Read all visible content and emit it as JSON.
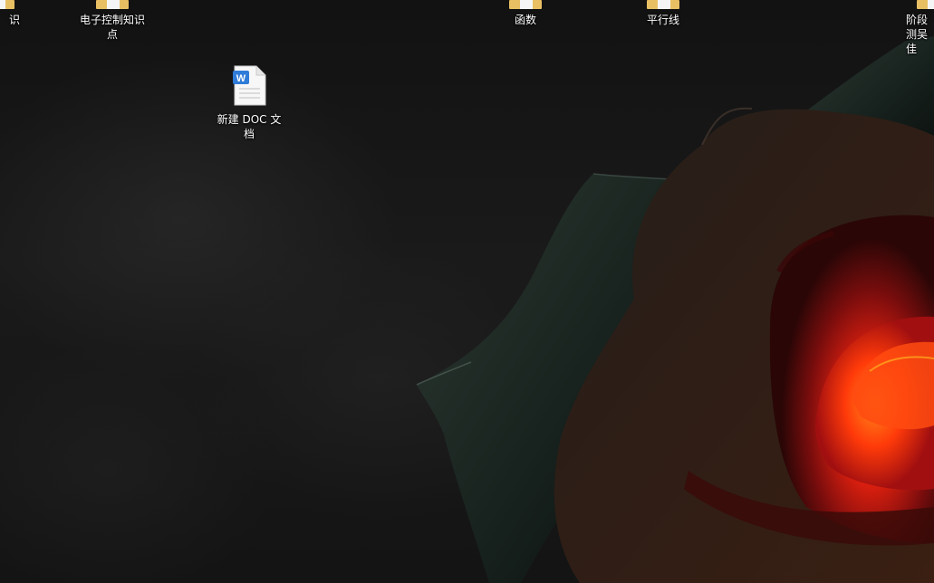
{
  "desktop": {
    "icons": [
      {
        "label": "识",
        "type": "folder"
      },
      {
        "label": "电子控制知识点",
        "type": "folder"
      },
      {
        "label": "函数",
        "type": "folder"
      },
      {
        "label": "平行线",
        "type": "folder"
      },
      {
        "label": "阶段测吴佳",
        "type": "folder"
      },
      {
        "label": "新建 DOC 文档",
        "type": "word-document",
        "badge": "W"
      }
    ]
  }
}
